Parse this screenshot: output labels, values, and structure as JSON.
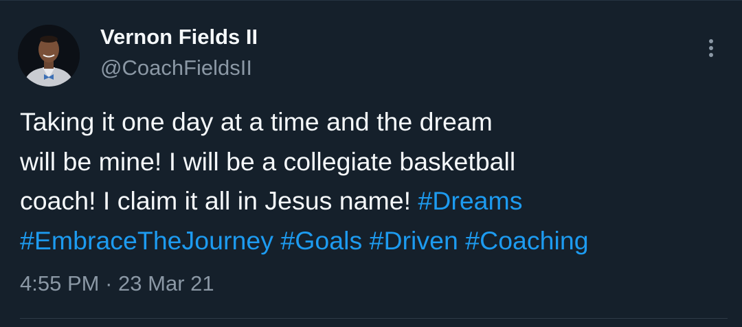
{
  "author": {
    "name": "Vernon Fields II",
    "handle": "@CoachFieldsII"
  },
  "tweet": {
    "line1": "Taking it one day at a time and the dream",
    "line2": "will be mine! I will be a collegiate basketball",
    "line3_text": "coach! I claim it all in Jesus name! ",
    "hashtags": [
      "#Dreams",
      "#EmbraceTheJourney",
      "#Goals",
      "#Driven",
      "#Coaching"
    ],
    "time": "4:55 PM",
    "separator": "·",
    "date": "23 Mar 21"
  },
  "icons": {
    "more": "vertical-ellipsis-icon"
  },
  "colors": {
    "background": "#15202b",
    "text": "#f5f8fa",
    "secondary_text": "#8b98a5",
    "hashtag": "#1d9bf0"
  }
}
